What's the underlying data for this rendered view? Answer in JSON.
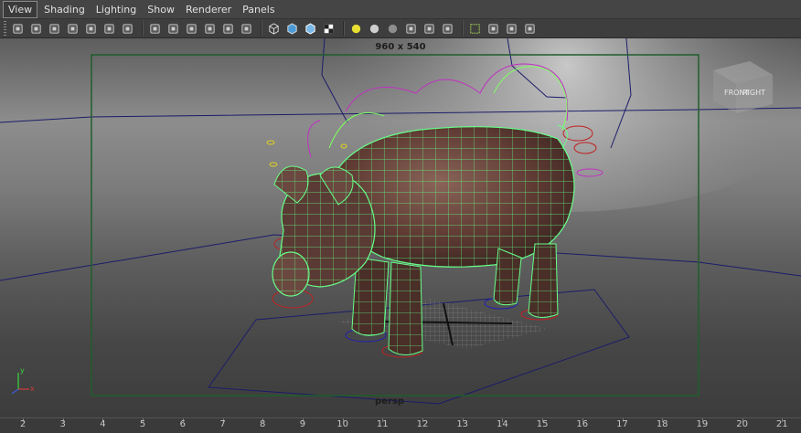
{
  "menubar": {
    "items": [
      {
        "label": "View"
      },
      {
        "label": "Shading"
      },
      {
        "label": "Lighting"
      },
      {
        "label": "Show"
      },
      {
        "label": "Renderer"
      },
      {
        "label": "Panels"
      }
    ]
  },
  "toolbar": {
    "icons": [
      "select-camera-icon",
      "camera-attributes-icon",
      "bookmarks-icon",
      "image-plane-icon",
      "2d-pan-zoom-icon",
      "grease-pencil-icon",
      "grid-icon",
      "film-gate-icon",
      "resolution-gate-icon",
      "gate-mask-icon",
      "field-chart-icon",
      "safe-action-icon",
      "safe-title-icon",
      "wireframe-icon",
      "smooth-shade-icon",
      "wireframe-on-shaded-icon",
      "textured-icon",
      "use-all-lights-icon",
      "shadows-icon",
      "screen-space-ao-icon",
      "motion-blur-icon",
      "anti-aliasing-icon",
      "depth-of-field-icon",
      "isolate-select-icon",
      "xray-icon",
      "xray-active-components-icon",
      "xray-joints-icon"
    ]
  },
  "viewport": {
    "resolution_label": "960 x 540",
    "camera_name": "persp",
    "view_cube": {
      "front": "FRONT",
      "right": "RIGHT"
    },
    "axis_labels": {
      "x": "x",
      "y": "y"
    },
    "colors": {
      "resolution_gate": "#1f5f2b",
      "wireframe": "#66ff88",
      "controls_magenta": "#c030c0",
      "controls_red": "#c02020",
      "controls_blue": "#2020b0",
      "controls_yellow": "#e0d020",
      "grid_lines": "#1c1c6a"
    }
  },
  "timeline": {
    "ticks": [
      "2",
      "3",
      "4",
      "5",
      "6",
      "7",
      "8",
      "9",
      "10",
      "11",
      "12",
      "13",
      "14",
      "15",
      "16",
      "17",
      "18",
      "19",
      "20",
      "21"
    ]
  }
}
